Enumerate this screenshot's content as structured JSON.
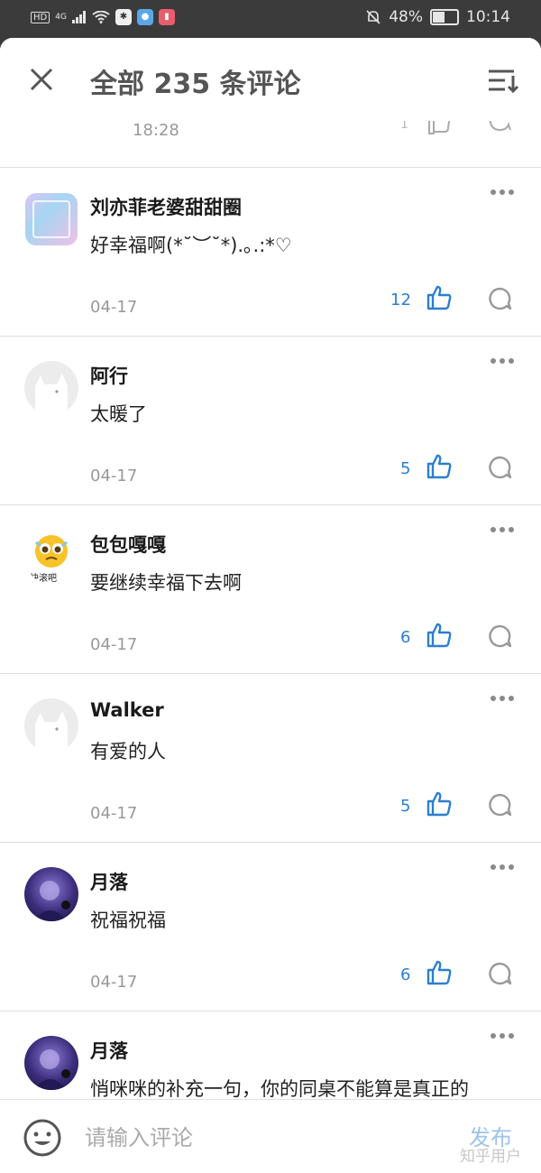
{
  "status_bar": {
    "hd": "HD",
    "signal": "4G",
    "battery_percent": "48%",
    "time": "10:14"
  },
  "header": {
    "title": "全部 235 条评论"
  },
  "partial_comment": {
    "time": "18:28",
    "like_count": "1"
  },
  "comments": [
    {
      "author": "刘亦菲老婆甜甜圈",
      "content": "好幸福啊(*˘︶˘*).｡.:*♡",
      "date": "04-17",
      "likes": "12",
      "avatar": "gradient"
    },
    {
      "author": "阿行",
      "content": "太暖了",
      "date": "04-17",
      "likes": "5",
      "avatar": "default"
    },
    {
      "author": "包包嘎嘎",
      "content": "要继续幸福下去啊",
      "date": "04-17",
      "likes": "6",
      "avatar": "emoji",
      "avatar_text": "快滚吧"
    },
    {
      "author": "Walker",
      "content": "有爱的人",
      "date": "04-17",
      "likes": "5",
      "avatar": "default"
    },
    {
      "author": "月落",
      "content": "祝福祝福",
      "date": "04-17",
      "likes": "6",
      "avatar": "photo"
    },
    {
      "author": "月落",
      "content": "悄咪咪的补充一句，你的同桌不能算是真正的",
      "date": "",
      "likes": "",
      "avatar": "photo"
    }
  ],
  "input": {
    "placeholder": "请输入评论",
    "publish_label": "发布"
  },
  "watermark": "知乎用户",
  "colors": {
    "accent": "#2b7fd0",
    "text_secondary": "#999999",
    "status_bar_bg": "#3b3b3b"
  }
}
